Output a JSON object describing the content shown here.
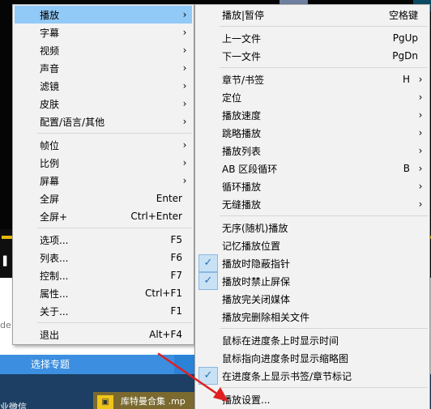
{
  "background": {
    "topic_label": "选择专题",
    "side_text": "de",
    "wechat_text": "业微信",
    "card_text": "库特曼合集 .mp"
  },
  "left_menu": {
    "items": [
      {
        "label": "播放",
        "shortcut": "",
        "has_submenu": true,
        "highlighted": true
      },
      {
        "label": "字幕",
        "shortcut": "",
        "has_submenu": true
      },
      {
        "label": "视频",
        "shortcut": "",
        "has_submenu": true
      },
      {
        "label": "声音",
        "shortcut": "",
        "has_submenu": true
      },
      {
        "label": "滤镜",
        "shortcut": "",
        "has_submenu": true
      },
      {
        "label": "皮肤",
        "shortcut": "",
        "has_submenu": true
      },
      {
        "label": "配置/语言/其他",
        "shortcut": "",
        "has_submenu": true
      },
      {
        "label": "帧位",
        "shortcut": "",
        "has_submenu": true
      },
      {
        "label": "比例",
        "shortcut": "",
        "has_submenu": true
      },
      {
        "label": "屏幕",
        "shortcut": "",
        "has_submenu": true
      },
      {
        "label": "全屏",
        "shortcut": "Enter",
        "has_submenu": false
      },
      {
        "label": "全屏+",
        "shortcut": "Ctrl+Enter",
        "has_submenu": false
      },
      {
        "label": "选项...",
        "shortcut": "F5",
        "has_submenu": false
      },
      {
        "label": "列表...",
        "shortcut": "F6",
        "has_submenu": false
      },
      {
        "label": "控制...",
        "shortcut": "F7",
        "has_submenu": false
      },
      {
        "label": "属性...",
        "shortcut": "Ctrl+F1",
        "has_submenu": false
      },
      {
        "label": "关于...",
        "shortcut": "F1",
        "has_submenu": false
      },
      {
        "label": "退出",
        "shortcut": "Alt+F4",
        "has_submenu": false
      }
    ]
  },
  "right_menu": {
    "items": [
      {
        "label": "播放|暂停",
        "shortcut": "空格键",
        "has_submenu": false
      },
      {
        "label": "上一文件",
        "shortcut": "PgUp",
        "has_submenu": false
      },
      {
        "label": "下一文件",
        "shortcut": "PgDn",
        "has_submenu": false
      },
      {
        "label": "章节/书签",
        "shortcut": "H",
        "has_submenu": true
      },
      {
        "label": "定位",
        "shortcut": "",
        "has_submenu": true
      },
      {
        "label": "播放速度",
        "shortcut": "",
        "has_submenu": true
      },
      {
        "label": "跳略播放",
        "shortcut": "",
        "has_submenu": true
      },
      {
        "label": "播放列表",
        "shortcut": "",
        "has_submenu": true
      },
      {
        "label": "AB 区段循环",
        "shortcut": "B",
        "has_submenu": true
      },
      {
        "label": "循环播放",
        "shortcut": "",
        "has_submenu": true
      },
      {
        "label": "无缝播放",
        "shortcut": "",
        "has_submenu": true
      },
      {
        "label": "无序(随机)播放",
        "shortcut": "",
        "has_submenu": false,
        "checked": false
      },
      {
        "label": "记忆播放位置",
        "shortcut": "",
        "has_submenu": false,
        "checked": false
      },
      {
        "label": "播放时隐蔽指针",
        "shortcut": "",
        "has_submenu": false,
        "checked": true
      },
      {
        "label": "播放时禁止屏保",
        "shortcut": "",
        "has_submenu": false,
        "checked": true
      },
      {
        "label": "播放完关闭媒体",
        "shortcut": "",
        "has_submenu": false,
        "checked": false
      },
      {
        "label": "播放完删除相关文件",
        "shortcut": "",
        "has_submenu": false,
        "checked": false
      },
      {
        "label": "鼠标在进度条上时显示时间",
        "shortcut": "",
        "has_submenu": false,
        "checked": false
      },
      {
        "label": "鼠标指向进度条时显示缩略图",
        "shortcut": "",
        "has_submenu": false,
        "checked": false
      },
      {
        "label": "在进度条上显示书签/章节标记",
        "shortcut": "",
        "has_submenu": false,
        "checked": true
      },
      {
        "label": "播放设置...",
        "shortcut": "",
        "has_submenu": false,
        "checked": false
      }
    ]
  },
  "colors": {
    "menu_bg": "#f2f2f2",
    "highlight": "#91c9f7",
    "check_bg": "#c8e1f5",
    "annotation_arrow": "#e02020"
  }
}
